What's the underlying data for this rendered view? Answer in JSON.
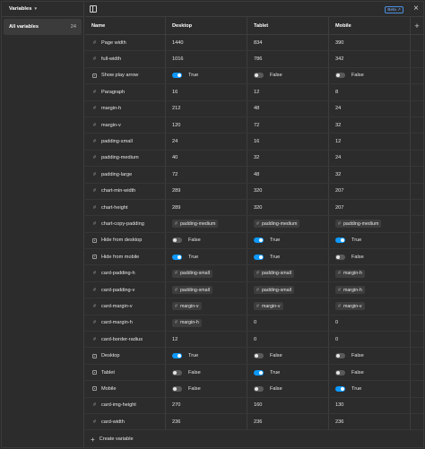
{
  "sidebar": {
    "title": "Variables",
    "collections": [
      {
        "label": "All variables",
        "count": "24"
      }
    ]
  },
  "topbar": {
    "beta_label": "Beta",
    "close_symbol": "×"
  },
  "table": {
    "columns": [
      "Name",
      "Desktop",
      "Tablet",
      "Mobile"
    ],
    "add_column_symbol": "+",
    "rows": [
      {
        "name": "Page width",
        "type": "number",
        "values": [
          {
            "kind": "text",
            "text": "1440"
          },
          {
            "kind": "text",
            "text": "834"
          },
          {
            "kind": "text",
            "text": "390"
          }
        ]
      },
      {
        "name": "full-width",
        "type": "number",
        "values": [
          {
            "kind": "text",
            "text": "1016"
          },
          {
            "kind": "text",
            "text": "786"
          },
          {
            "kind": "text",
            "text": "342"
          }
        ]
      },
      {
        "name": "Show play arrow",
        "type": "boolean",
        "values": [
          {
            "kind": "bool",
            "on": true,
            "text": "True"
          },
          {
            "kind": "bool",
            "on": false,
            "text": "False"
          },
          {
            "kind": "bool",
            "on": false,
            "text": "False"
          }
        ]
      },
      {
        "name": "Paragraph",
        "type": "number",
        "values": [
          {
            "kind": "text",
            "text": "16"
          },
          {
            "kind": "text",
            "text": "12"
          },
          {
            "kind": "text",
            "text": "8"
          }
        ]
      },
      {
        "name": "margin-h",
        "type": "number",
        "values": [
          {
            "kind": "text",
            "text": "212"
          },
          {
            "kind": "text",
            "text": "48"
          },
          {
            "kind": "text",
            "text": "24"
          }
        ]
      },
      {
        "name": "margin-v",
        "type": "number",
        "values": [
          {
            "kind": "text",
            "text": "120"
          },
          {
            "kind": "text",
            "text": "72"
          },
          {
            "kind": "text",
            "text": "32"
          }
        ]
      },
      {
        "name": "padding-small",
        "type": "number",
        "values": [
          {
            "kind": "text",
            "text": "24"
          },
          {
            "kind": "text",
            "text": "16"
          },
          {
            "kind": "text",
            "text": "12"
          }
        ]
      },
      {
        "name": "padding-medium",
        "type": "number",
        "values": [
          {
            "kind": "text",
            "text": "40"
          },
          {
            "kind": "text",
            "text": "32"
          },
          {
            "kind": "text",
            "text": "24"
          }
        ]
      },
      {
        "name": "padding-large",
        "type": "number",
        "values": [
          {
            "kind": "text",
            "text": "72"
          },
          {
            "kind": "text",
            "text": "48"
          },
          {
            "kind": "text",
            "text": "32"
          }
        ]
      },
      {
        "name": "chart-min-width",
        "type": "number",
        "values": [
          {
            "kind": "text",
            "text": "289"
          },
          {
            "kind": "text",
            "text": "320"
          },
          {
            "kind": "text",
            "text": "207"
          }
        ]
      },
      {
        "name": "chart-height",
        "type": "number",
        "values": [
          {
            "kind": "text",
            "text": "289"
          },
          {
            "kind": "text",
            "text": "320"
          },
          {
            "kind": "text",
            "text": "207"
          }
        ]
      },
      {
        "name": "chart-copy-padding",
        "type": "number",
        "values": [
          {
            "kind": "alias",
            "text": "padding-medium"
          },
          {
            "kind": "alias",
            "text": "padding-medium"
          },
          {
            "kind": "alias",
            "text": "padding-medium"
          }
        ]
      },
      {
        "name": "Hide from desktop",
        "type": "boolean",
        "values": [
          {
            "kind": "bool",
            "on": false,
            "text": "False"
          },
          {
            "kind": "bool",
            "on": true,
            "text": "True"
          },
          {
            "kind": "bool",
            "on": true,
            "text": "True"
          }
        ]
      },
      {
        "name": "Hide from mobile",
        "type": "boolean",
        "values": [
          {
            "kind": "bool",
            "on": true,
            "text": "True"
          },
          {
            "kind": "bool",
            "on": true,
            "text": "True"
          },
          {
            "kind": "bool",
            "on": false,
            "text": "False"
          }
        ]
      },
      {
        "name": "card-padding-h",
        "type": "number",
        "values": [
          {
            "kind": "alias",
            "text": "padding-small"
          },
          {
            "kind": "alias",
            "text": "padding-small"
          },
          {
            "kind": "alias",
            "text": "margin-h"
          }
        ]
      },
      {
        "name": "card-padding-v",
        "type": "number",
        "values": [
          {
            "kind": "alias",
            "text": "padding-small"
          },
          {
            "kind": "alias",
            "text": "padding-small"
          },
          {
            "kind": "alias",
            "text": "margin-h"
          }
        ]
      },
      {
        "name": "card-margin-v",
        "type": "number",
        "values": [
          {
            "kind": "alias",
            "text": "margin-v"
          },
          {
            "kind": "alias",
            "text": "margin-v"
          },
          {
            "kind": "alias",
            "text": "margin-v"
          }
        ]
      },
      {
        "name": "card-margin-h",
        "type": "number",
        "values": [
          {
            "kind": "alias",
            "text": "margin-h"
          },
          {
            "kind": "text",
            "text": "0"
          },
          {
            "kind": "text",
            "text": "0"
          }
        ]
      },
      {
        "name": "card-border-radius",
        "type": "number",
        "values": [
          {
            "kind": "text",
            "text": "12"
          },
          {
            "kind": "text",
            "text": "0"
          },
          {
            "kind": "text",
            "text": "0"
          }
        ]
      },
      {
        "name": "Desktop",
        "type": "boolean",
        "values": [
          {
            "kind": "bool",
            "on": true,
            "text": "True"
          },
          {
            "kind": "bool",
            "on": false,
            "text": "False"
          },
          {
            "kind": "bool",
            "on": false,
            "text": "False"
          }
        ]
      },
      {
        "name": "Tablet",
        "type": "boolean",
        "values": [
          {
            "kind": "bool",
            "on": false,
            "text": "False"
          },
          {
            "kind": "bool",
            "on": true,
            "text": "True"
          },
          {
            "kind": "bool",
            "on": false,
            "text": "False"
          }
        ]
      },
      {
        "name": "Mobile",
        "type": "boolean",
        "values": [
          {
            "kind": "bool",
            "on": false,
            "text": "False"
          },
          {
            "kind": "bool",
            "on": false,
            "text": "False"
          },
          {
            "kind": "bool",
            "on": true,
            "text": "True"
          }
        ]
      },
      {
        "name": "card-img-height",
        "type": "number",
        "values": [
          {
            "kind": "text",
            "text": "270"
          },
          {
            "kind": "text",
            "text": "160"
          },
          {
            "kind": "text",
            "text": "130"
          }
        ]
      },
      {
        "name": "card-width",
        "type": "number",
        "values": [
          {
            "kind": "text",
            "text": "236"
          },
          {
            "kind": "text",
            "text": "236"
          },
          {
            "kind": "text",
            "text": "236"
          }
        ]
      }
    ]
  },
  "footer": {
    "create_label": "Create variable",
    "plus_symbol": "+"
  },
  "colors": {
    "accent": "#0d99ff",
    "background": "#2c2c2c",
    "border": "#3d3d3d"
  },
  "icons": {
    "number_type": "hash-icon",
    "boolean_type": "boolean-icon",
    "panel_toggle": "sidebar-toggle-icon",
    "close": "close-icon"
  }
}
